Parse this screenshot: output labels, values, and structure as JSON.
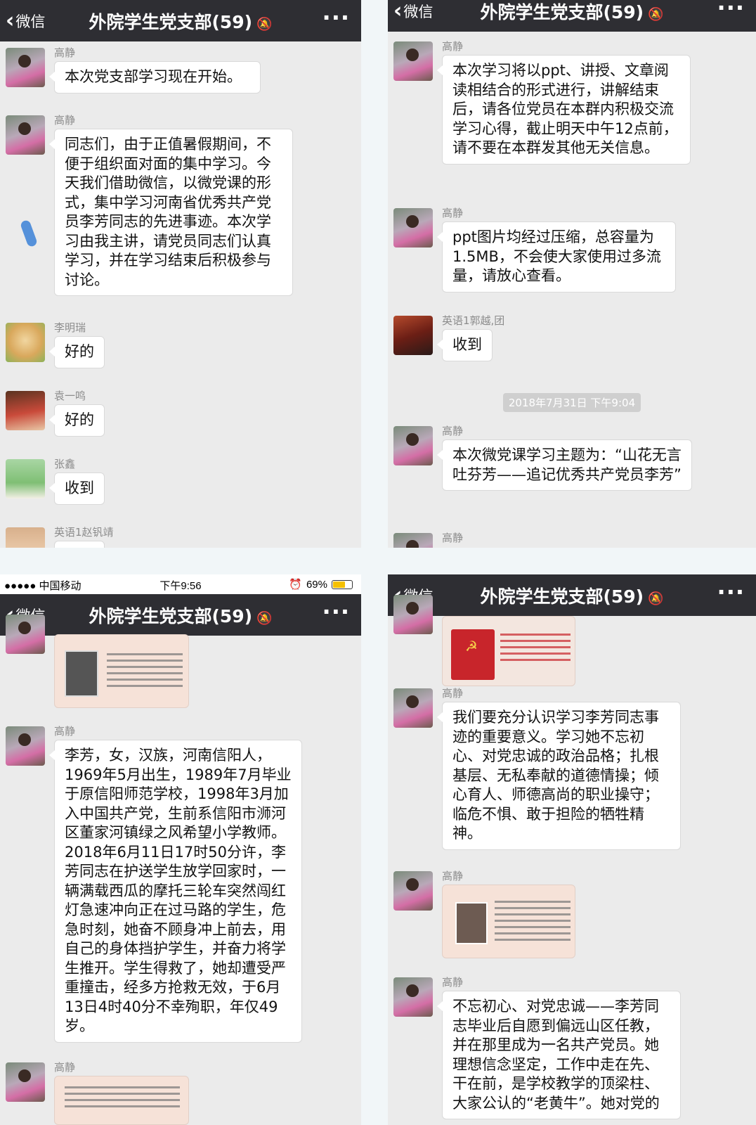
{
  "header": {
    "back_label": "微信",
    "title": "外院学生党支部(59)",
    "mute_icon": "mute-icon",
    "more_icon": "more-icon"
  },
  "status_bar": {
    "carrier": "●●●●● 中国移动",
    "time": "下午9:56",
    "battery": "69%",
    "battery_level": 0.69
  },
  "panel1": {
    "messages": [
      {
        "sender": "高静",
        "text": "本次党支部学习现在开始。"
      },
      {
        "sender": "高静",
        "text": "同志们，由于正值暑假期间，不便于组织面对面的集中学习。今天我们借助微信，以微党课的形式，集中学习河南省优秀共产党员李芳同志的先进事迹。本次学习由我主讲，请党员同志们认真学习，并在学习结束后积极参与讨论。"
      },
      {
        "sender": "李明瑞",
        "text": "好的"
      },
      {
        "sender": "袁一鸣",
        "text": "好的"
      },
      {
        "sender": "张鑫",
        "text": "收到"
      },
      {
        "sender": "英语1赵钒靖",
        "text": ""
      }
    ]
  },
  "panel2": {
    "messages": [
      {
        "sender": "高静",
        "text": "本次学习将以ppt、讲授、文章阅读相结合的形式进行，讲解结束后，请各位党员在本群内积极交流学习心得，截止明天中午12点前，请不要在本群发其他无关信息。"
      },
      {
        "sender": "高静",
        "text": "ppt图片均经过压缩，总容量为1.5MB，不会使大家使用过多流量，请放心查看。"
      },
      {
        "sender": "英语1郭越,团",
        "text": "收到"
      },
      {
        "sender": "高静",
        "text": "本次微党课学习主题为：“山花无言吐芬芳——追记优秀共产党员李芳”"
      },
      {
        "sender": "高静",
        "text": ""
      }
    ],
    "timestamp": "2018年7月31日 下午9:04"
  },
  "panel3": {
    "messages": [
      {
        "sender": "高静",
        "text": "李芳，女，汉族，河南信阳人，1969年5月出生，1989年7月毕业于原信阳师范学校，1998年3月加入中国共产党，生前系信阳市浉河区董家河镇绿之风希望小学教师。2018年6月11日17时50分许，李芳同志在护送学生放学回家时，一辆满载西瓜的摩托三轮车突然闯红灯急速冲向正在过马路的学生，危急时刻，她奋不顾身冲上前去，用自己的身体挡护学生，并奋力将学生推开。学生得救了，她却遭受严重撞击，经多方抢救无效，于6月13日4时40分不幸殉职，年仅49岁。"
      },
      {
        "sender": "高静",
        "text": ""
      }
    ]
  },
  "panel4": {
    "messages": [
      {
        "sender": "高静",
        "text": "我们要充分认识学习李芳同志事迹的重要意义。学习她不忘初心、对党忠诚的政治品格；扎根基层、无私奉献的道德情操；倾心育人、师德高尚的职业操守；临危不惧、敢于担险的牺牲精神。"
      },
      {
        "sender": "高静",
        "text": ""
      },
      {
        "sender": "高静",
        "text": "不忘初心、对党忠诚——李芳同志毕业后自愿到偏远山区任教，并在那里成为一名共产党员。她理想信念坚定，工作中走在先、干在前，是学校教学的顶梁柱、大家公认的“老黄牛”。她对党的"
      }
    ]
  }
}
